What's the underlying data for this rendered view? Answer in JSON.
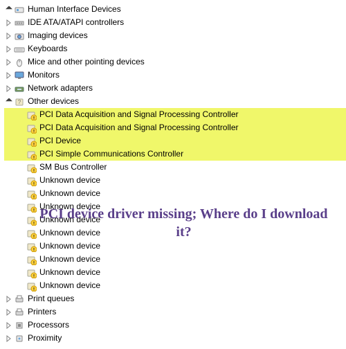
{
  "overlay_text": "PCI device driver missing; Where do I download it?",
  "tree": {
    "top": [
      {
        "label": "Human Interface Devices",
        "icon": "hid",
        "open": true
      },
      {
        "label": "IDE ATA/ATAPI controllers",
        "icon": "ide",
        "open": false
      },
      {
        "label": "Imaging devices",
        "icon": "imaging",
        "open": false
      },
      {
        "label": "Keyboards",
        "icon": "keyboard",
        "open": false
      },
      {
        "label": "Mice and other pointing devices",
        "icon": "mouse",
        "open": false
      },
      {
        "label": "Monitors",
        "icon": "monitor",
        "open": false
      },
      {
        "label": "Network adapters",
        "icon": "network",
        "open": false
      }
    ],
    "other": {
      "label": "Other devices",
      "icon": "other",
      "open": true
    },
    "children": [
      {
        "label": "PCI Data Acquisition and Signal Processing Controller",
        "warn": true,
        "hl": true
      },
      {
        "label": "PCI Data Acquisition and Signal Processing Controller",
        "warn": true,
        "hl": true
      },
      {
        "label": "PCI Device",
        "warn": true,
        "hl": true
      },
      {
        "label": "PCI Simple Communications Controller",
        "warn": true,
        "hl": true
      },
      {
        "label": "SM Bus Controller",
        "warn": true,
        "hl": false
      },
      {
        "label": "Unknown device",
        "warn": true,
        "hl": false
      },
      {
        "label": "Unknown device",
        "warn": true,
        "hl": false
      },
      {
        "label": "Unknown device",
        "warn": true,
        "hl": false
      },
      {
        "label": "Unknown device",
        "warn": true,
        "hl": false
      },
      {
        "label": "Unknown device",
        "warn": true,
        "hl": false
      },
      {
        "label": "Unknown device",
        "warn": true,
        "hl": false
      },
      {
        "label": "Unknown device",
        "warn": true,
        "hl": false
      },
      {
        "label": "Unknown device",
        "warn": true,
        "hl": false
      },
      {
        "label": "Unknown device",
        "warn": true,
        "hl": false
      }
    ],
    "bottom": [
      {
        "label": "Print queues",
        "icon": "printer",
        "open": false
      },
      {
        "label": "Printers",
        "icon": "printer",
        "open": false
      },
      {
        "label": "Processors",
        "icon": "cpu",
        "open": false
      },
      {
        "label": "Proximity",
        "icon": "proximity",
        "open": false
      }
    ]
  }
}
